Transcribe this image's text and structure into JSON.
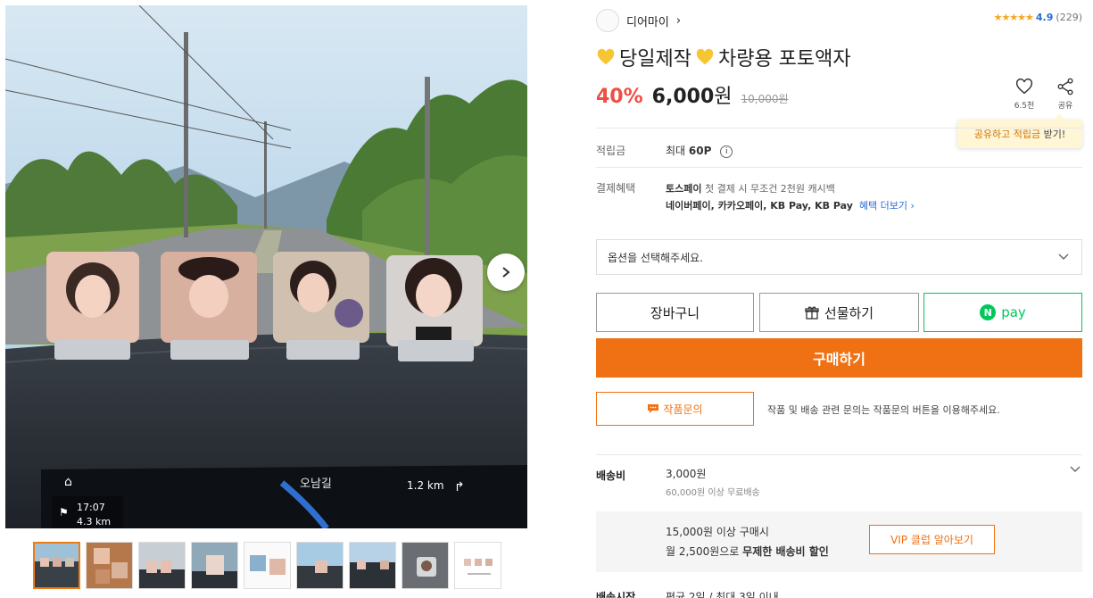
{
  "seller": {
    "name": "디어마이",
    "arrow": "›"
  },
  "rating": {
    "stars": "★★★★★",
    "score": "4.9",
    "count": "(229)"
  },
  "product": {
    "title": "당일제작",
    "title_rest": "차량용 포토액자",
    "discount": "40%",
    "price": "6,000",
    "currency": "원",
    "original_price": "10,000원"
  },
  "actions": {
    "like_count": "6.5천",
    "share_label": "공유",
    "share_tip_prefix": "공유하고 적립금",
    "share_tip_suffix": "받기!"
  },
  "points": {
    "label": "적립금",
    "value_prefix": "최대",
    "value": "60P",
    "info_icon": "i"
  },
  "payment": {
    "label": "결제혜택",
    "line1_bold": "토스페이",
    "line1_rest": "첫 결제 시 무조건 2천원 캐시백",
    "line2": "네이버페이, 카카오페이, KB Pay, KB Pay",
    "more": "혜택 더보기 ›"
  },
  "option_select": {
    "placeholder": "옵션을 선택해주세요."
  },
  "buttons": {
    "cart": "장바구니",
    "gift": "선물하기",
    "npay_n": "N",
    "npay": "pay",
    "buy": "구매하기",
    "inquiry": "작품문의",
    "inquiry_note": "작품 및 배송 관련 문의는 작품문의 버튼을 이용해주세요."
  },
  "shipping": {
    "label": "배송비",
    "price": "3,000원",
    "free_condition": "60,000원 이상 무료배송"
  },
  "vip": {
    "line1": "15,000원 이상 구매시",
    "line2_prefix": "월 2,500원으로",
    "line2_bold": "무제한 배송비 할인",
    "button": "VIP 클럽 알아보기"
  },
  "ship_start": {
    "label": "배송시작",
    "value": "평균 2일 / 최대 3일 이내"
  },
  "photo": {
    "nav_time": "17:07",
    "nav_dist": "4.3 km",
    "road_name": "오남길",
    "turn_dist": "1.2 km"
  },
  "colors": {
    "accent": "#ef7114",
    "discount": "#f04e45",
    "npay": "#03c75a",
    "link": "#2a6bd8"
  }
}
